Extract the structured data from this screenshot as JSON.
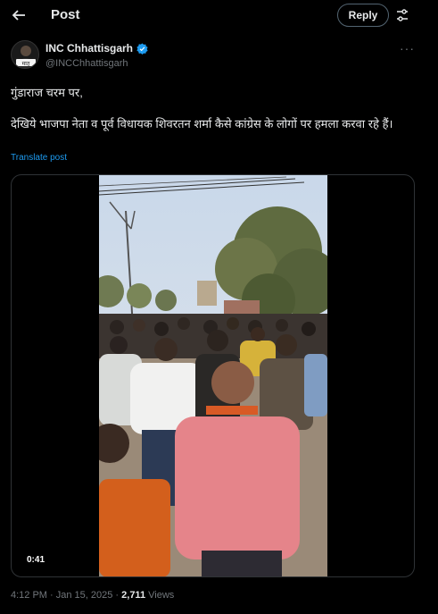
{
  "header": {
    "title": "Post",
    "reply_label": "Reply"
  },
  "post": {
    "author_name": "INC Chhattisgarh",
    "author_handle": "@INCChhattisgarh",
    "avatar_text": "मातृ",
    "text_line1": "गुंडाराज चरम पर,",
    "text_line2": "देखिये भाजपा नेता व पूर्व विधायक शिवरतन शर्मा कैसे कांग्रेस के लोगों पर हमला करवा रहे हैं।",
    "translate_label": "Translate post",
    "video_duration": "0:41",
    "time": "4:12 PM · Jan 15, 2025 · ",
    "views_count": "2,711",
    "views_label": " Views"
  },
  "colors": {
    "accent": "#1d9bf0",
    "background": "#000000",
    "secondary_text": "#71767b"
  },
  "icons": [
    "back-arrow-icon",
    "settings-sliders-icon",
    "verified-badge-icon",
    "more-icon"
  ]
}
